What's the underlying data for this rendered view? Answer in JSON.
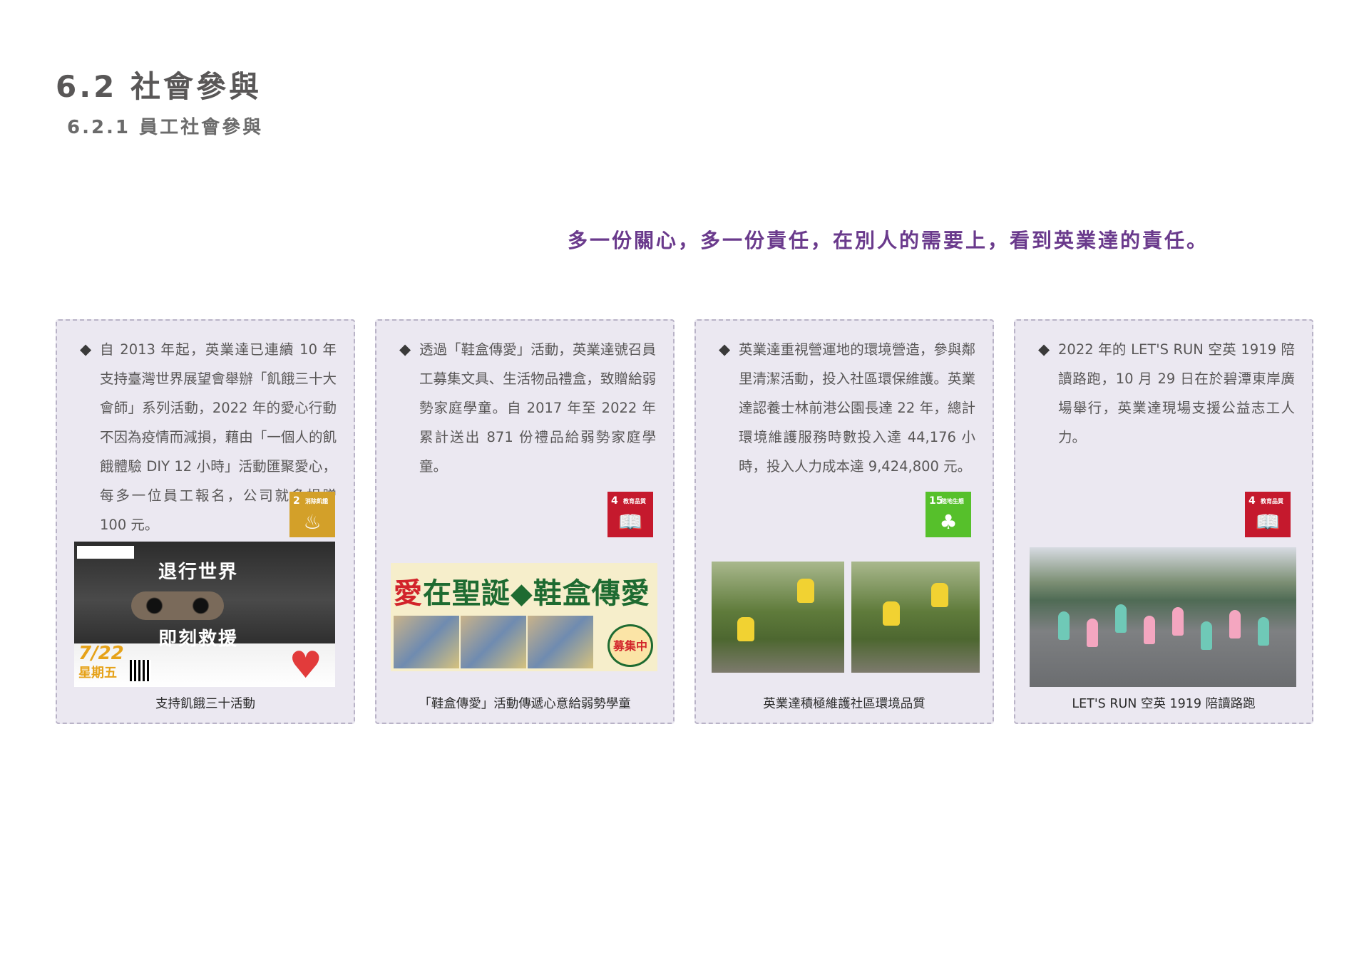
{
  "heading": {
    "section": "6.2 社會參與",
    "subsection": "6.2.1 員工社會參與"
  },
  "slogan": "多一份關心，多一份責任，在別人的需要上，看到英業達的責任。",
  "cards": [
    {
      "bullet": "◆",
      "text": "自 2013 年起，英業達已連續 10 年支持臺灣世界展望會舉辦「飢餓三十大會師」系列活動，2022 年的愛心行動不因為疫情而減損，藉由「一個人的飢餓體驗 DIY 12 小時」活動匯聚愛心，每多一位員工報名，公司就多捐贈 100 元。",
      "sdg": {
        "num": "2",
        "label": "消除飢餓",
        "icon": "bowl-icon",
        "color": "#d3a029"
      },
      "photo": {
        "headline": "退行世界",
        "subline": "即刻救援",
        "date": "7/22",
        "day": "星期五"
      },
      "caption": "支持飢餓三十活動"
    },
    {
      "bullet": "◆",
      "text": "透過「鞋盒傳愛」活動，英業達號召員工募集文具、生活物品禮盒，致贈給弱勢家庭學童。自 2017 年至 2022 年累計送出 871 份禮品給弱勢家庭學童。",
      "sdg": {
        "num": "4",
        "label": "教育品質",
        "icon": "book-icon",
        "color": "#c5192d"
      },
      "photo": {
        "title_red": "愛",
        "title_green": "在聖誕◆鞋盒傳愛",
        "badge": "募集中"
      },
      "caption": "「鞋盒傳愛」活動傳遞心意給弱勢學童"
    },
    {
      "bullet": "◆",
      "text": "英業達重視營運地的環境營造，參與鄰里清潔活動，投入社區環保維護。英業達認養士林前港公園長達 22 年，總計環境維護服務時數投入達 44,176 小時，投入人力成本達 9,424,800 元。",
      "sdg": {
        "num": "15",
        "label": "陸地生態",
        "icon": "tree-icon",
        "color": "#56c02b"
      },
      "caption": "英業達積極維護社區環境品質"
    },
    {
      "bullet": "◆",
      "text": "2022 年的 LET'S RUN 空英 1919 陪讀路跑，10 月 29 日在於碧潭東岸廣場舉行，英業達現場支援公益志工人力。",
      "sdg": {
        "num": "4",
        "label": "教育品質",
        "icon": "book-icon",
        "color": "#c5192d"
      },
      "caption": "LET'S RUN 空英 1919 陪讀路跑"
    }
  ]
}
